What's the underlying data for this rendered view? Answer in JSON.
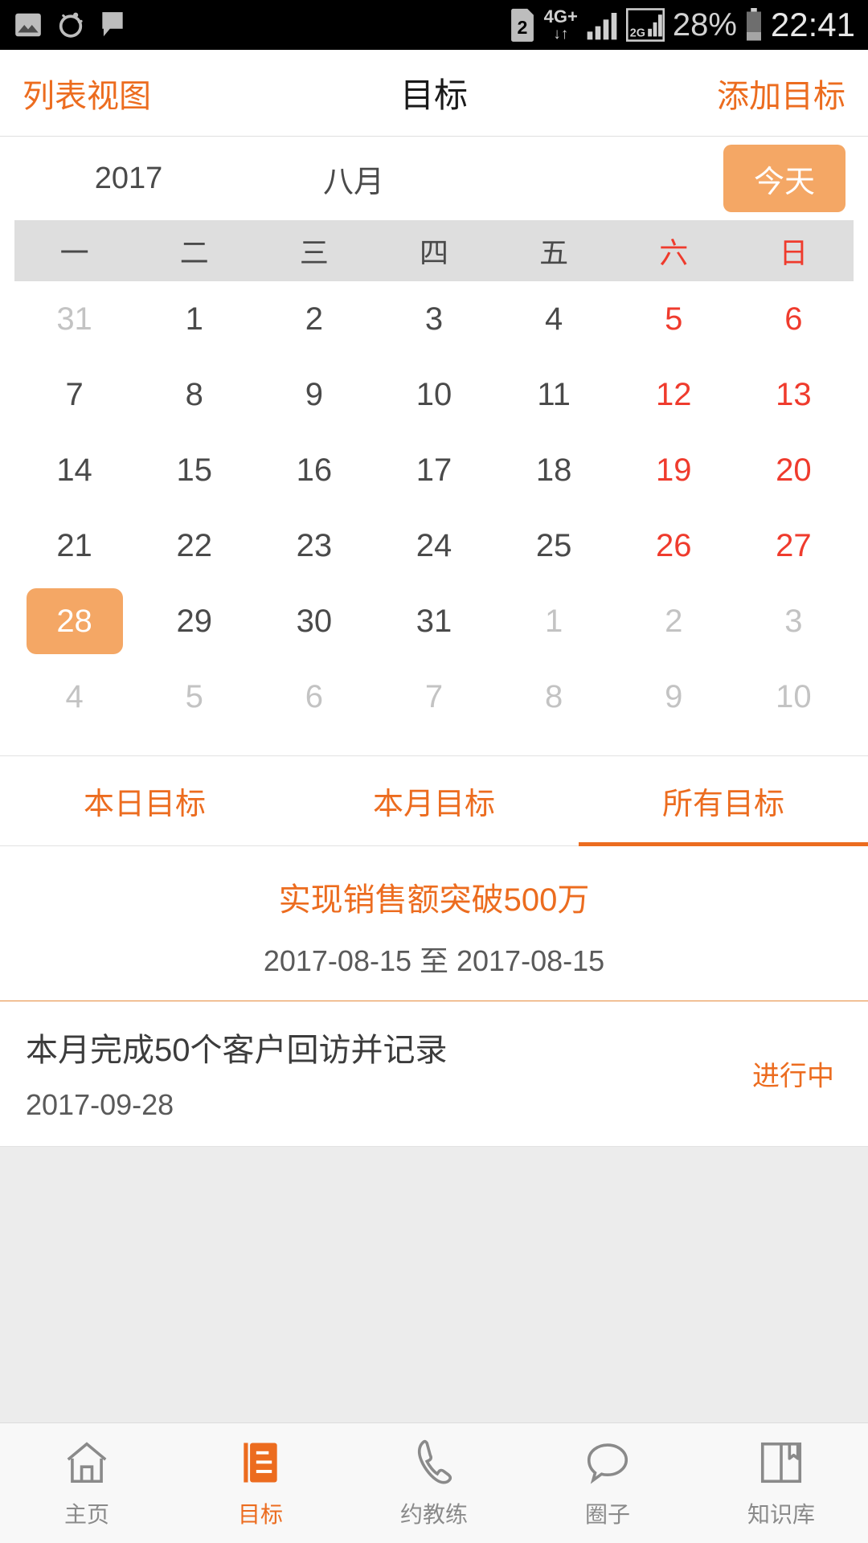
{
  "statusbar": {
    "icons": [
      "image-icon",
      "weather-icon",
      "message-icon"
    ],
    "sim_badge": "2",
    "network_type": "4G+",
    "network_arrows": "↓↑",
    "secondary_network": "2G",
    "battery_percent": "28%",
    "time": "22:41"
  },
  "navbar": {
    "left_action": "列表视图",
    "title": "目标",
    "right_action": "添加目标"
  },
  "calendar": {
    "year": "2017",
    "month": "八月",
    "today_button": "今天",
    "weekdays": [
      "一",
      "二",
      "三",
      "四",
      "五",
      "六",
      "日"
    ],
    "weekend_indices": [
      5,
      6
    ],
    "selected_day": "28",
    "weeks": [
      [
        {
          "d": "31",
          "muted": true
        },
        {
          "d": "1"
        },
        {
          "d": "2"
        },
        {
          "d": "3"
        },
        {
          "d": "4"
        },
        {
          "d": "5",
          "weekend": true
        },
        {
          "d": "6",
          "weekend": true
        }
      ],
      [
        {
          "d": "7"
        },
        {
          "d": "8"
        },
        {
          "d": "9"
        },
        {
          "d": "10"
        },
        {
          "d": "11"
        },
        {
          "d": "12",
          "weekend": true
        },
        {
          "d": "13",
          "weekend": true
        }
      ],
      [
        {
          "d": "14"
        },
        {
          "d": "15"
        },
        {
          "d": "16"
        },
        {
          "d": "17"
        },
        {
          "d": "18"
        },
        {
          "d": "19",
          "weekend": true
        },
        {
          "d": "20",
          "weekend": true
        }
      ],
      [
        {
          "d": "21"
        },
        {
          "d": "22"
        },
        {
          "d": "23"
        },
        {
          "d": "24"
        },
        {
          "d": "25"
        },
        {
          "d": "26",
          "weekend": true
        },
        {
          "d": "27",
          "weekend": true
        }
      ],
      [
        {
          "d": "28",
          "selected": true
        },
        {
          "d": "29"
        },
        {
          "d": "30"
        },
        {
          "d": "31"
        },
        {
          "d": "1",
          "muted": true
        },
        {
          "d": "2",
          "muted": true
        },
        {
          "d": "3",
          "muted": true
        }
      ],
      [
        {
          "d": "4",
          "muted": true
        },
        {
          "d": "5",
          "muted": true
        },
        {
          "d": "6",
          "muted": true
        },
        {
          "d": "7",
          "muted": true
        },
        {
          "d": "8",
          "muted": true
        },
        {
          "d": "9",
          "muted": true
        },
        {
          "d": "10",
          "muted": true
        }
      ]
    ]
  },
  "tabs": [
    {
      "label": "本日目标",
      "active": false
    },
    {
      "label": "本月目标",
      "active": false
    },
    {
      "label": "所有目标",
      "active": true
    }
  ],
  "goals": [
    {
      "title": "实现销售额突破500万",
      "date": "2017-08-15 至 2017-08-15",
      "status": "",
      "centered": true
    },
    {
      "title": "本月完成50个客户回访并记录",
      "date": "2017-09-28",
      "status": "进行中",
      "centered": false
    }
  ],
  "tabbar": [
    {
      "label": "主页",
      "icon": "home-icon",
      "active": false
    },
    {
      "label": "目标",
      "icon": "notebook-icon",
      "active": true
    },
    {
      "label": "约教练",
      "icon": "phone-icon",
      "active": false
    },
    {
      "label": "圈子",
      "icon": "chat-bubble-icon",
      "active": false
    },
    {
      "label": "知识库",
      "icon": "book-icon",
      "active": false
    }
  ],
  "colors": {
    "accent": "#ec6c1f",
    "accent_light": "#f4a765",
    "weekend_red": "#ef3b2d",
    "text_dark": "#3c3c3c",
    "text_muted": "#c3c3c3",
    "weekday_bg": "#dedede",
    "filler_bg": "#ececec"
  }
}
